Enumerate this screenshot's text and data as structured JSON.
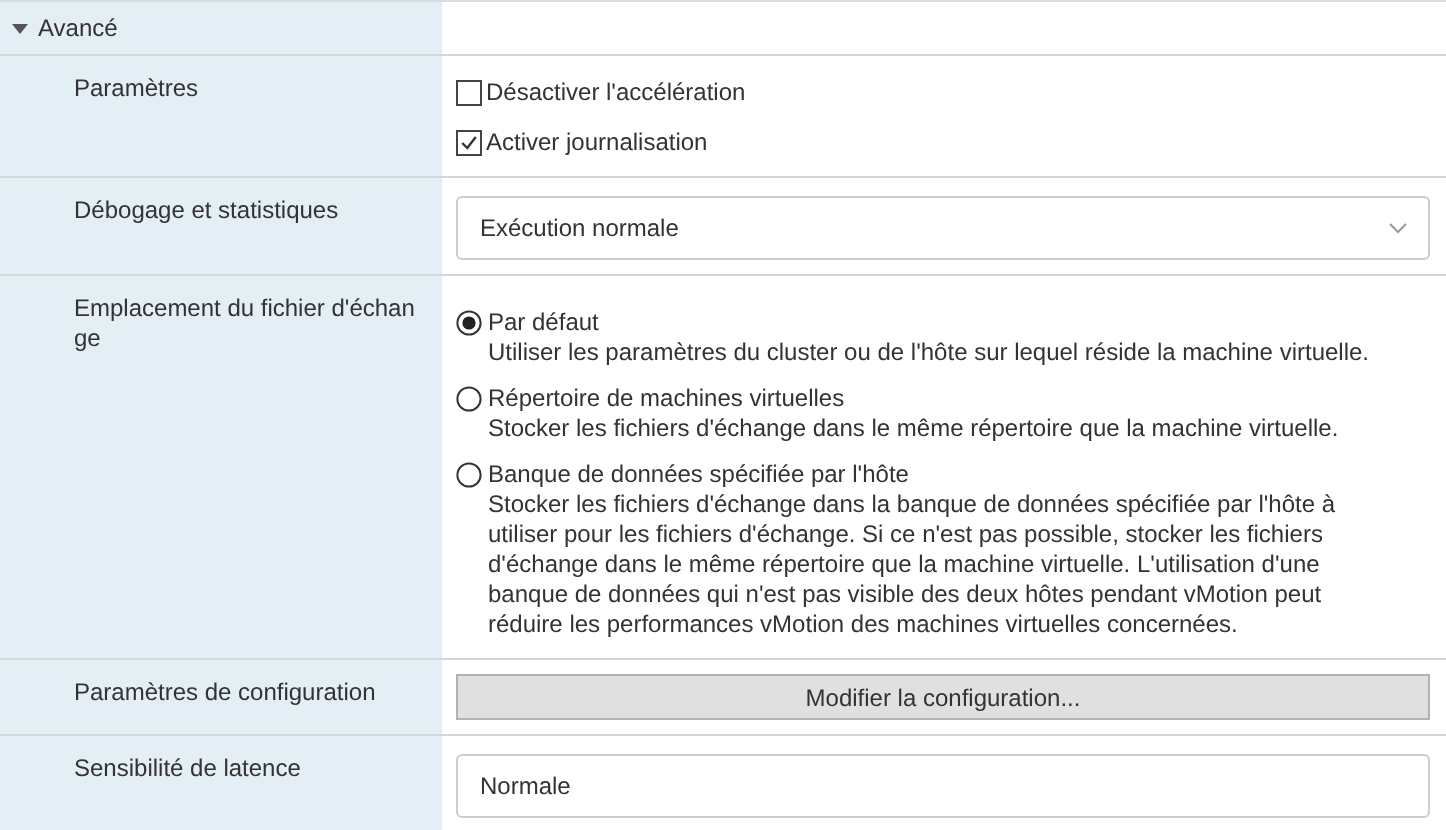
{
  "section": {
    "title": "Avancé",
    "expanded": true
  },
  "rows": [
    {
      "kind": "checkboxes",
      "label": "Paramètres",
      "options": [
        {
          "label": "Désactiver l'accélération",
          "checked": false
        },
        {
          "label": "Activer journalisation",
          "checked": true
        }
      ]
    },
    {
      "kind": "select",
      "label": "Débogage et statistiques",
      "value": "Exécution normale",
      "has_caret": true
    },
    {
      "kind": "radios",
      "label": "Emplacement du fichier d'échange",
      "options": [
        {
          "label": "Par défaut",
          "description": "Utiliser les paramètres du cluster ou de l'hôte sur lequel réside la machine virtuelle.",
          "selected": true
        },
        {
          "label": "Répertoire de machines virtuelles",
          "description": "Stocker les fichiers d'échange dans le même répertoire que la machine virtuelle.",
          "selected": false
        },
        {
          "label": "Banque de données spécifiée par l'hôte",
          "description": "Stocker les fichiers d'échange dans la banque de données spécifiée par l'hôte à utiliser pour les fichiers d'échange. Si ce n'est pas possible, stocker les fichiers d'échange dans le même répertoire que la machine virtuelle. L'utilisation d'une banque de données qui n'est pas visible des deux hôtes pendant vMotion peut réduire les performances vMotion des machines virtuelles concernées.",
          "selected": false
        }
      ]
    },
    {
      "kind": "button",
      "label": "Paramètres de configuration",
      "button": "Modifier la configuration..."
    },
    {
      "kind": "select",
      "label": "Sensibilité de latence",
      "value": "Normale",
      "has_caret": false
    }
  ]
}
